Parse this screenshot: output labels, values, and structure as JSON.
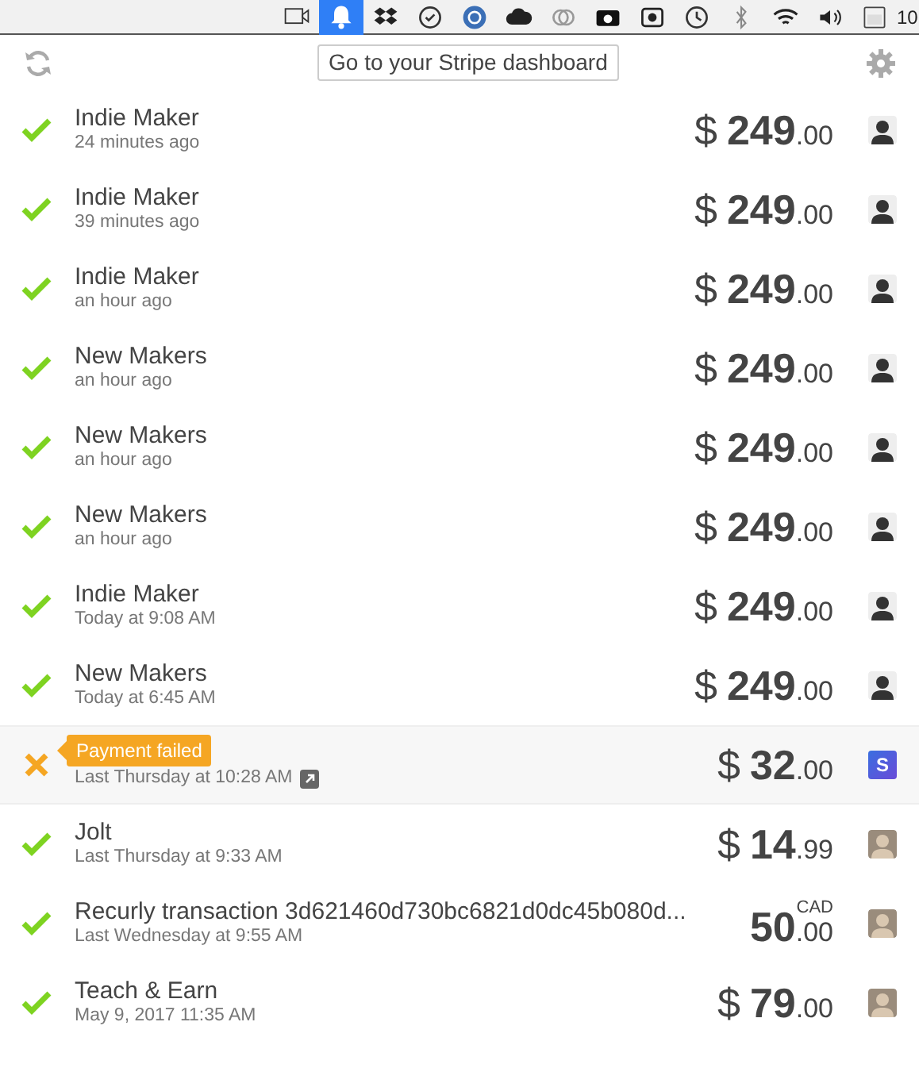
{
  "menubar": {
    "icons": [
      {
        "kind": "camera",
        "selected": false
      },
      {
        "kind": "bell",
        "selected": true
      },
      {
        "kind": "dropbox",
        "selected": false
      },
      {
        "kind": "check",
        "selected": false
      },
      {
        "kind": "te",
        "selected": false
      },
      {
        "kind": "cloud",
        "selected": false
      },
      {
        "kind": "rings",
        "selected": false
      },
      {
        "kind": "photo",
        "selected": false
      },
      {
        "kind": "record",
        "selected": false
      },
      {
        "kind": "history",
        "selected": false
      },
      {
        "kind": "bluetooth",
        "selected": false
      },
      {
        "kind": "wifi",
        "selected": false
      },
      {
        "kind": "volume",
        "selected": false
      },
      {
        "kind": "keyboard",
        "selected": false
      }
    ],
    "clock": "10"
  },
  "toolbar": {
    "dashboard_button": "Go to your Stripe dashboard"
  },
  "payments": [
    {
      "failed": false,
      "highlighted": false,
      "title": "Indie Maker",
      "time": "24 minutes ago",
      "currency": "$",
      "whole": "249",
      "cents": ".00",
      "avatar": {
        "kind": "photo",
        "color": "#eeeeee"
      }
    },
    {
      "failed": false,
      "highlighted": false,
      "title": "Indie Maker",
      "time": "39 minutes ago",
      "currency": "$",
      "whole": "249",
      "cents": ".00",
      "avatar": {
        "kind": "photo",
        "color": "#eeeeee"
      }
    },
    {
      "failed": false,
      "highlighted": false,
      "title": "Indie Maker",
      "time": "an hour ago",
      "currency": "$",
      "whole": "249",
      "cents": ".00",
      "avatar": {
        "kind": "photo",
        "color": "#eeeeee"
      }
    },
    {
      "failed": false,
      "highlighted": false,
      "title": "New Makers",
      "time": "an hour ago",
      "currency": "$",
      "whole": "249",
      "cents": ".00",
      "avatar": {
        "kind": "photo",
        "color": "#eeeeee"
      }
    },
    {
      "failed": false,
      "highlighted": false,
      "title": "New Makers",
      "time": "an hour ago",
      "currency": "$",
      "whole": "249",
      "cents": ".00",
      "avatar": {
        "kind": "photo",
        "color": "#eeeeee"
      }
    },
    {
      "failed": false,
      "highlighted": false,
      "title": "New Makers",
      "time": "an hour ago",
      "currency": "$",
      "whole": "249",
      "cents": ".00",
      "avatar": {
        "kind": "photo",
        "color": "#eeeeee"
      }
    },
    {
      "failed": false,
      "highlighted": false,
      "title": "Indie Maker",
      "time": "Today at 9:08 AM",
      "currency": "$",
      "whole": "249",
      "cents": ".00",
      "avatar": {
        "kind": "photo",
        "color": "#eeeeee"
      }
    },
    {
      "failed": false,
      "highlighted": false,
      "title": "New Makers",
      "time": "Today at 6:45 AM",
      "currency": "$",
      "whole": "249",
      "cents": ".00",
      "avatar": {
        "kind": "photo",
        "color": "#eeeeee"
      }
    },
    {
      "failed": true,
      "highlighted": true,
      "tooltip": "Payment failed",
      "time": "Last Thursday at 10:28 AM",
      "external_link": true,
      "currency": "$",
      "whole": "32",
      "cents": ".00",
      "avatar": {
        "kind": "logo",
        "text": "S"
      }
    },
    {
      "failed": false,
      "highlighted": false,
      "title": "Jolt",
      "time": "Last Thursday at 9:33 AM",
      "currency": "$",
      "whole": "14",
      "cents": ".99",
      "avatar": {
        "kind": "photo",
        "color": "#9a8c7c"
      }
    },
    {
      "failed": false,
      "highlighted": false,
      "title": "Recurly transaction 3d621460d730bc6821d0dc45b080d...",
      "time": "Last Wednesday at 9:55 AM",
      "currency_code": "CAD",
      "whole": "50",
      "cents": ".00",
      "avatar": {
        "kind": "photo",
        "color": "#9a8c7c"
      }
    },
    {
      "failed": false,
      "highlighted": false,
      "title": "Teach & Earn",
      "time": "May 9, 2017 11:35 AM",
      "currency": "$",
      "whole": "79",
      "cents": ".00",
      "avatar": {
        "kind": "photo",
        "color": "#9a8c7c"
      }
    }
  ]
}
